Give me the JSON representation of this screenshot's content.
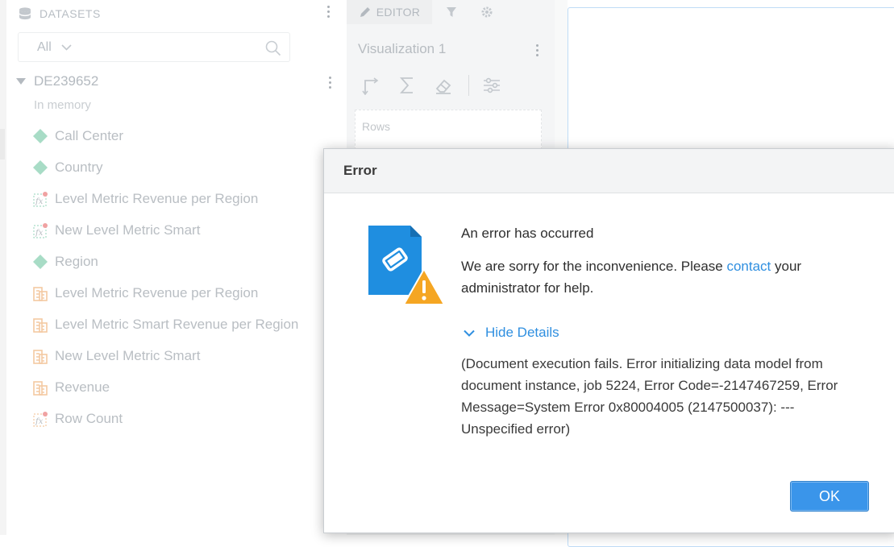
{
  "datasets": {
    "header": "DATASETS",
    "filter_value": "All",
    "dataset_name": "DE239652",
    "dataset_subtitle": "In memory",
    "objects": [
      {
        "label": "Call Center",
        "kind": "attribute"
      },
      {
        "label": "Country",
        "kind": "attribute"
      },
      {
        "label": "Level Metric Revenue per Region",
        "kind": "derived-metric"
      },
      {
        "label": "New Level Metric Smart",
        "kind": "derived-metric"
      },
      {
        "label": "Region",
        "kind": "attribute"
      },
      {
        "label": "Level Metric Revenue per Region",
        "kind": "metric"
      },
      {
        "label": "Level Metric Smart Revenue per Region",
        "kind": "metric"
      },
      {
        "label": "New Level Metric Smart",
        "kind": "metric"
      },
      {
        "label": "Revenue",
        "kind": "metric"
      },
      {
        "label": "Row Count",
        "kind": "formula"
      }
    ]
  },
  "editor": {
    "tab_label": "EDITOR",
    "viz_title": "Visualization 1",
    "rows_label": "Rows"
  },
  "dialog": {
    "title": "Error",
    "heading": "An error has occurred",
    "message_before": "We are sorry for the inconvenience. Please ",
    "message_link": "contact",
    "message_after": " your administrator for help.",
    "toggle_label": "Hide Details",
    "details": "(Document execution fails. Error initializing data model from document instance, job 5224, Error Code=-2147467259, Error Message=System Error 0x80004005 (2147500037): --- Unspecified error)",
    "ok_label": "OK"
  },
  "colors": {
    "accent": "#2f8fe0",
    "ok_button": "#3a95ea",
    "warning": "#f5a623",
    "doc_icon": "#1f8ee0"
  }
}
